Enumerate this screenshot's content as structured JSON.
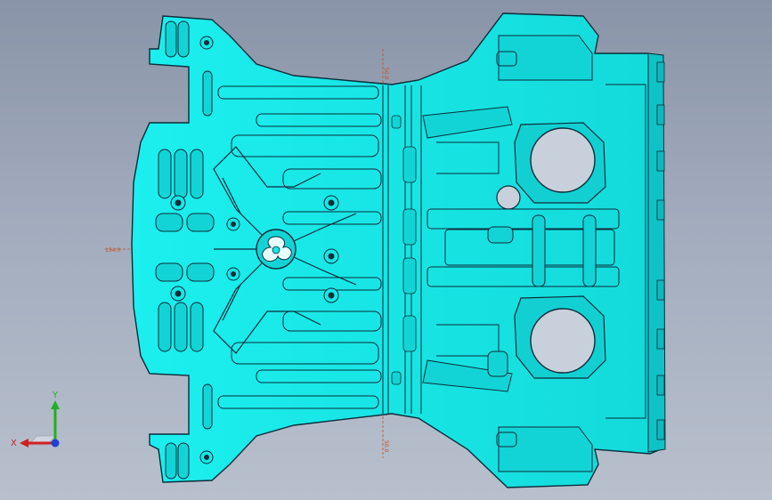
{
  "viewport": {
    "background_top": "#8a94a8",
    "background_bottom": "#b8c0cd"
  },
  "model": {
    "name": "engine-block-underside-plate",
    "fill_color": "#16e8e8",
    "edge_color": "#0a2d3a",
    "shadow_color": "#0fb8bd"
  },
  "dimensions": {
    "top_label": "50.0",
    "left_label": "154.0",
    "bottom_label": "50.0"
  },
  "triad": {
    "x_label": "X",
    "y_label": "Y",
    "x_color": "#d22020",
    "y_color": "#20b020",
    "z_color": "#2040d0"
  }
}
